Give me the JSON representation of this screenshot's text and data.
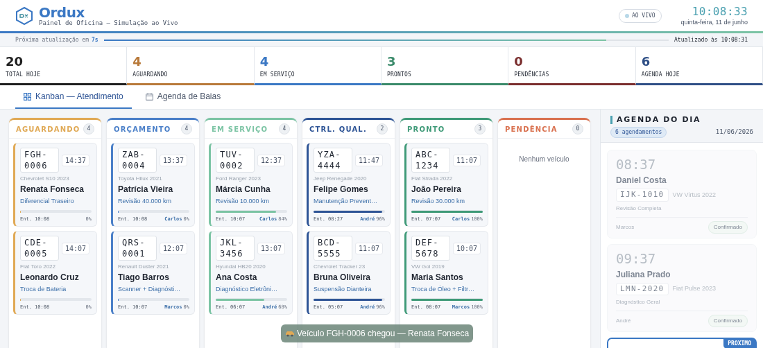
{
  "header": {
    "brand": "Ordux",
    "subtitle": "Painel de Oficina — Simulação ao Vivo",
    "live": {
      "label": "AO VIVO",
      "on": true
    },
    "clock": "10:08:33",
    "date": "quinta-feira, 11 de junho"
  },
  "refresh": {
    "label": "Próxima atualização em",
    "countdown": "7s",
    "level": 0.89,
    "updated": "Atualizado às 10:08:31"
  },
  "stats": [
    {
      "value": "20",
      "label": "TOTAL HOJE",
      "color": "#1f1f1f"
    },
    {
      "value": "4",
      "label": "AGUARDANDO",
      "color": "#b8793a"
    },
    {
      "value": "4",
      "label": "EM SERVIÇO",
      "color": "#3b78c4"
    },
    {
      "value": "3",
      "label": "PRONTOS",
      "color": "#3a8a6a"
    },
    {
      "value": "0",
      "label": "PENDÊNCIAS",
      "color": "#7a2e2e"
    },
    {
      "value": "6",
      "label": "AGENDA HOJE",
      "color": "#2f4f86"
    }
  ],
  "tabs": [
    {
      "label": "Kanban — Atendimento",
      "selected": true
    },
    {
      "label": "Agenda de Baias",
      "selected": false
    }
  ],
  "columns": [
    {
      "title": "AGUARDANDO",
      "count": "4",
      "color": "#e0a955",
      "cards": [
        {
          "plate": "FGH-0006",
          "time": "14:37",
          "vehicle": "Chevrolet S10 2023",
          "client": "Renata Fonseca",
          "service": "Diferencial Traseiro",
          "level": 0,
          "entry": "Ent. 10:08",
          "percent": "0%"
        },
        {
          "plate": "CDE-0005",
          "time": "14:07",
          "vehicle": "Fiat Toro 2022",
          "client": "Leonardo Cruz",
          "service": "Troca de Bateria",
          "level": 0,
          "entry": "Ent. 10:08",
          "percent": "0%"
        }
      ]
    },
    {
      "title": "ORÇAMENTO",
      "count": "4",
      "color": "#4a7fc8",
      "cards": [
        {
          "plate": "ZAB-0004",
          "time": "13:37",
          "vehicle": "Toyota Hilux 2021",
          "client": "Patrícia Vieira",
          "service": "Revisão 40.000 km",
          "level": 0,
          "entry": "Ent. 10:08",
          "tech": "Carlos",
          "percent": "0%"
        },
        {
          "plate": "QRS-0001",
          "time": "12:07",
          "vehicle": "Renault Duster 2021",
          "client": "Tiago Barros",
          "service": "Scanner + Diagnósti…",
          "level": 0,
          "entry": "Ent. 10:07",
          "tech": "Marcos",
          "percent": "0%"
        }
      ]
    },
    {
      "title": "EM SERVIÇO",
      "count": "4",
      "color": "#7cc4a4",
      "cards": [
        {
          "plate": "TUV-0002",
          "time": "12:37",
          "vehicle": "Ford Ranger 2023",
          "client": "Márcia Cunha",
          "service": "Revisão 10.000 km",
          "level": 0.84,
          "entry": "Ent. 10:07",
          "tech": "Carlos",
          "percent": "84%"
        },
        {
          "plate": "JKL-3456",
          "time": "13:07",
          "vehicle": "Hyundai HB20 2020",
          "client": "Ana Costa",
          "service": "Diagnóstico Eletrôni…",
          "level": 0.68,
          "entry": "Ent. 06:07",
          "tech": "André",
          "percent": "68%"
        }
      ]
    },
    {
      "title": "CTRL. QUAL.",
      "count": "2",
      "color": "#2f5596",
      "cards": [
        {
          "plate": "YZA-4444",
          "time": "11:47",
          "vehicle": "Jeep Renegade 2020",
          "client": "Felipe Gomes",
          "service": "Manutenção Prevent…",
          "level": 0.96,
          "entry": "Ent. 08:27",
          "tech": "André",
          "percent": "96%"
        },
        {
          "plate": "BCD-5555",
          "time": "11:07",
          "vehicle": "Chevrolet Tracker 23",
          "client": "Bruna Oliveira",
          "service": "Suspensão Dianteira",
          "level": 0.96,
          "entry": "Ent. 05:07",
          "tech": "André",
          "percent": "96%"
        }
      ]
    },
    {
      "title": "PRONTO",
      "count": "3",
      "color": "#3f9a78",
      "cards": [
        {
          "plate": "ABC-1234",
          "time": "11:07",
          "vehicle": "Fiat Strada 2022",
          "client": "João Pereira",
          "service": "Revisão 30.000 km",
          "level": 1,
          "entry": "Ent. 07:07",
          "tech": "Carlos",
          "percent": "100%"
        },
        {
          "plate": "DEF-5678",
          "time": "10:07",
          "vehicle": "VW Gol 2019",
          "client": "Maria Santos",
          "service": "Troca de Óleo + Filtr…",
          "level": 1,
          "entry": "Ent. 08:07",
          "tech": "Marcos",
          "percent": "100%"
        }
      ]
    },
    {
      "title": "PENDÊNCIA",
      "count": "0",
      "color": "#d9714f",
      "empty": "Nenhum veículo"
    }
  ],
  "agenda": {
    "title": "AGENDA DO DIA",
    "badge": "6 agendamentos",
    "date": "11/06/2026",
    "items": [
      {
        "time": "08:37",
        "client": "Daniel Costa",
        "plate": "IJK-1010",
        "vehicle": "VW Virtus 2022",
        "service": "Revisão Completa",
        "tech": "Marcos",
        "status": "Confirmado",
        "past": true
      },
      {
        "time": "09:37",
        "client": "Juliana Prado",
        "plate": "LMN-2020",
        "vehicle": "Fiat Pulse 2023",
        "service": "Diagnóstico Geral",
        "tech": "André",
        "status": "Confirmado",
        "past": true
      },
      {
        "tag": "PROXIMO",
        "past": false
      }
    ]
  },
  "toast": "Veículo FGH-0006 chegou — Renata Fonseca"
}
